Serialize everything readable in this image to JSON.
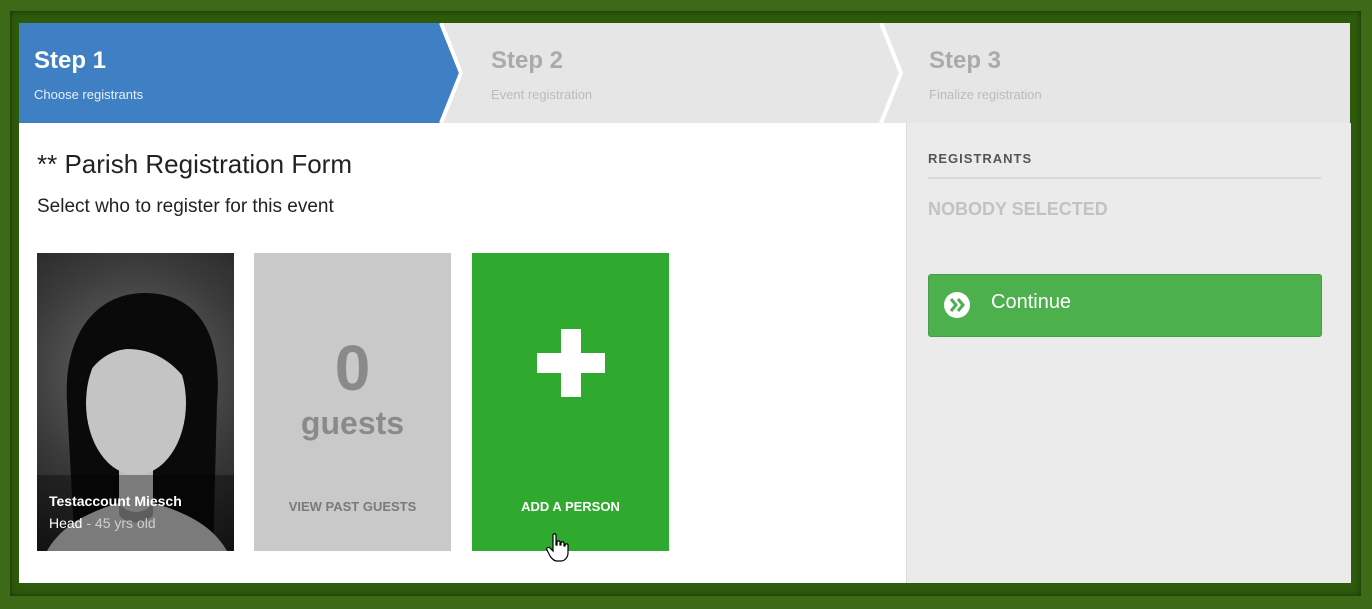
{
  "steps": [
    {
      "title": "Step 1",
      "subtitle": "Choose registrants",
      "active": true
    },
    {
      "title": "Step 2",
      "subtitle": "Event registration",
      "active": false
    },
    {
      "title": "Step 3",
      "subtitle": "Finalize registration",
      "active": false
    }
  ],
  "main": {
    "title": "** Parish Registration Form",
    "subtitle": "Select who to register for this event"
  },
  "cards": {
    "person": {
      "name": "Testaccount Miesch",
      "role": "Head",
      "age": "- 45 yrs old"
    },
    "guests": {
      "count": "0",
      "label": "guests",
      "link": "VIEW PAST GUESTS"
    },
    "add": {
      "label": "ADD A PERSON"
    }
  },
  "sidebar": {
    "heading": "REGISTRANTS",
    "empty": "NOBODY SELECTED",
    "continue_label": "Continue"
  },
  "colors": {
    "active_step": "#3f7fc3",
    "add_card": "#2faa2f",
    "continue": "#4cb04c",
    "frame": "#3d6a16"
  },
  "icons": {
    "add": "plus-icon",
    "continue": "double-chevron-right-icon",
    "avatar": "avatar-placeholder-icon",
    "cursor": "hand-pointer-icon"
  }
}
